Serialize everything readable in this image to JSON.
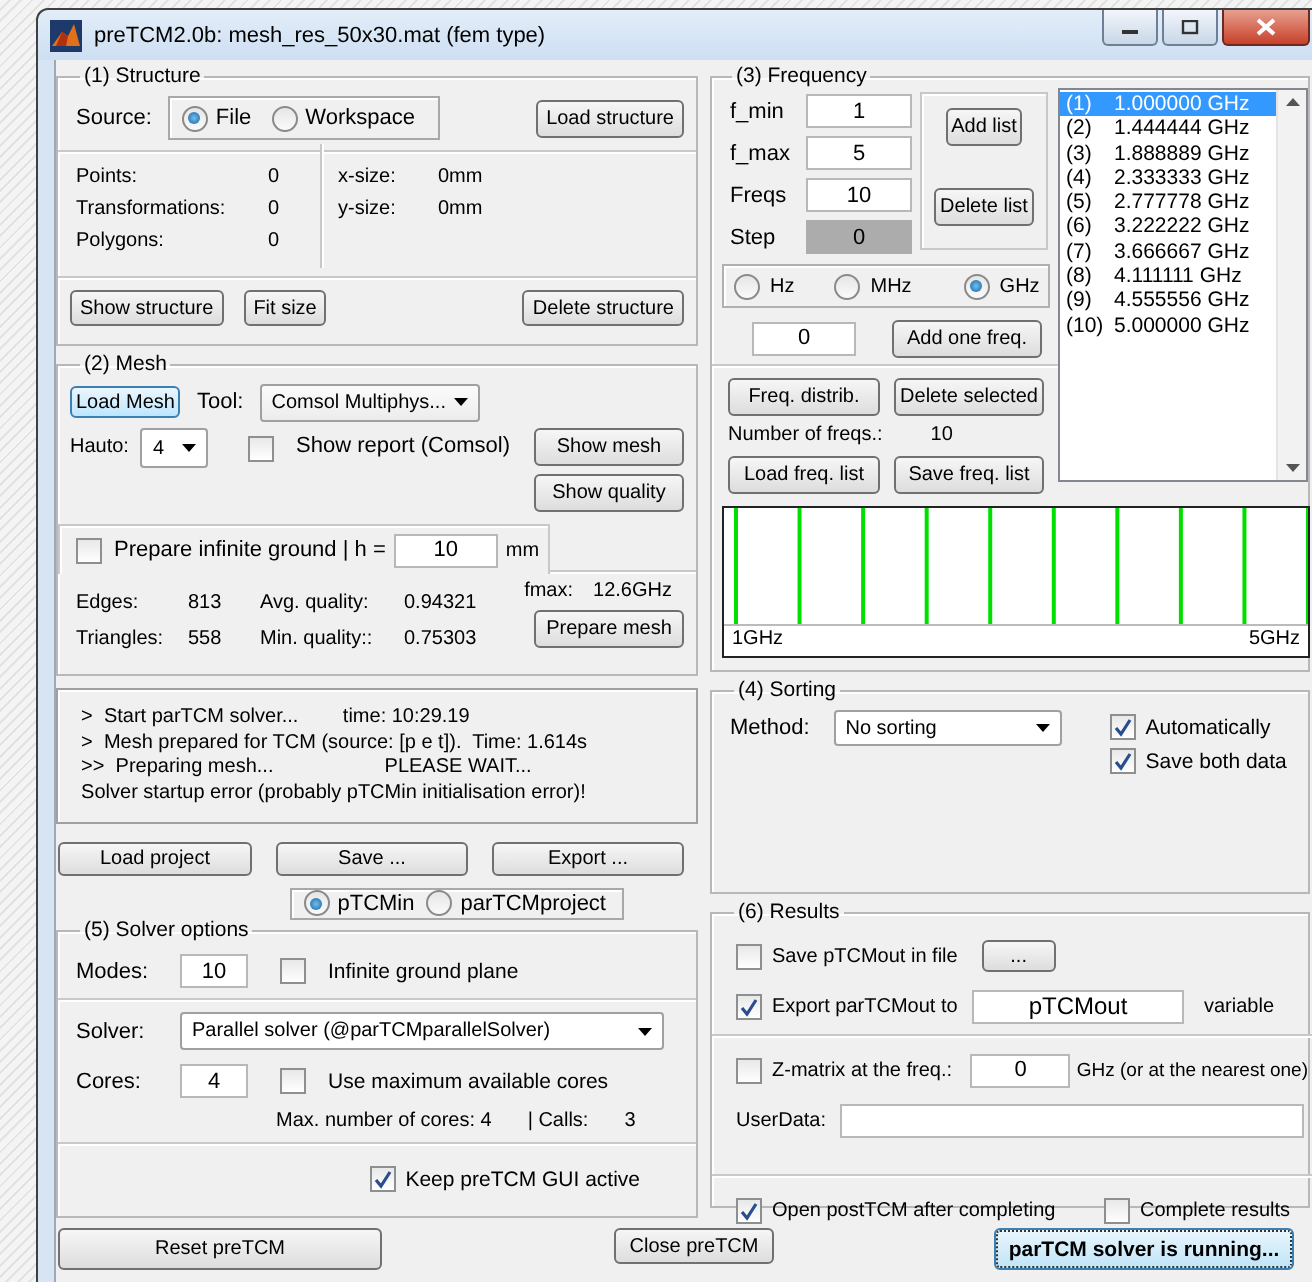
{
  "window": {
    "title": "preTCM2.0b:  mesh_res_50x30.mat (fem type)"
  },
  "structure": {
    "title": "(1) Structure",
    "source_label": "Source:",
    "sources": [
      {
        "label": "File",
        "selected": true
      },
      {
        "label": "Workspace",
        "selected": false
      }
    ],
    "load_button": "Load structure",
    "stats": [
      {
        "label": "Points:",
        "value": "0"
      },
      {
        "label": "Transformations:",
        "value": "0"
      },
      {
        "label": "Polygons:",
        "value": "0"
      }
    ],
    "sizes": [
      {
        "label": "x-size:",
        "value": "0mm"
      },
      {
        "label": "y-size:",
        "value": "0mm"
      }
    ],
    "buttons": [
      "Show structure",
      "Fit size",
      "Delete structure"
    ]
  },
  "mesh": {
    "title": "(2) Mesh",
    "load_button": "Load Mesh",
    "tool_label": "Tool:",
    "tool": "Comsol Multiphys...",
    "hauto_label": "Hauto:",
    "hauto": "4",
    "show_report": {
      "label": "Show report (Comsol)",
      "checked": false
    },
    "show_mesh": "Show mesh",
    "show_quality": "Show quality",
    "infinite_ground": {
      "label": "Prepare infinite ground  | h =",
      "checked": false
    },
    "h_value": "10",
    "h_unit": "mm",
    "fmax_label": "fmax:",
    "fmax": "12.6GHz",
    "stats": [
      {
        "label": "Edges:",
        "value": "813",
        "q_label": "Avg. quality:",
        "q_value": "0.94321"
      },
      {
        "label": "Triangles:",
        "value": "558",
        "q_label": "Min. quality::",
        "q_value": "0.75303"
      }
    ],
    "prepare_button": "Prepare mesh"
  },
  "log": [
    "  >  Start parTCM solver...        time: 10:29.19",
    "  >  Mesh prepared for TCM (source: [p e t]).  Time: 1.614s",
    "  >>  Preparing mesh...                    PLEASE WAIT...",
    "  Solver startup error (probably pTCMin initialisation error)!"
  ],
  "project_buttons": [
    "Load project",
    "Save ...",
    "Export ..."
  ],
  "project_source": [
    {
      "label": "pTCMin",
      "selected": true
    },
    {
      "label": "parTCMproject",
      "selected": false
    }
  ],
  "solver": {
    "title": "(5) Solver options",
    "modes_label": "Modes:",
    "modes": "10",
    "infinite_plane": {
      "label": "Infinite ground plane",
      "checked": false
    },
    "solver_label": "Solver:",
    "solver": "Parallel solver         (@parTCMparallelSolver)",
    "cores_label": "Cores:",
    "cores": "4",
    "use_max": {
      "label": "Use maximum available cores",
      "checked": false
    },
    "max_cores": "Max. number of cores: 4",
    "calls_label": "| Calls:",
    "calls": "3",
    "keep_active": {
      "label": "Keep preTCM GUI active",
      "checked": true
    }
  },
  "frequency": {
    "title": "(3) Frequency",
    "fields": [
      {
        "label": "f_min",
        "value": "1",
        "disabled": false
      },
      {
        "label": "f_max",
        "value": "5",
        "disabled": false
      },
      {
        "label": "Freqs",
        "value": "10",
        "disabled": false
      },
      {
        "label": "Step",
        "value": "0",
        "disabled": true
      }
    ],
    "add_list": "Add list",
    "delete_list": "Delete list",
    "units": [
      {
        "label": "Hz",
        "selected": false
      },
      {
        "label": "MHz",
        "selected": false
      },
      {
        "label": "GHz",
        "selected": true
      }
    ],
    "one_freq": "0",
    "add_one": "Add one freq.",
    "distrib": "Freq. distrib.",
    "delete_selected": "Delete selected",
    "count_label": "Number of freqs.:",
    "count": "10",
    "load_list": "Load freq. list",
    "save_list": "Save freq. list",
    "list": [
      {
        "index": "(1)",
        "value": "1.000000 GHz",
        "selected": true
      },
      {
        "index": "(2)",
        "value": "1.444444 GHz",
        "selected": false
      },
      {
        "index": "(3)",
        "value": "1.888889 GHz",
        "selected": false
      },
      {
        "index": "(4)",
        "value": "2.333333 GHz",
        "selected": false
      },
      {
        "index": "(5)",
        "value": "2.777778 GHz",
        "selected": false
      },
      {
        "index": "(6)",
        "value": "3.222222 GHz",
        "selected": false
      },
      {
        "index": "(7)",
        "value": "3.666667 GHz",
        "selected": false
      },
      {
        "index": "(8)",
        "value": "4.111111 GHz",
        "selected": false
      },
      {
        "index": "(9)",
        "value": "4.555556 GHz",
        "selected": false
      },
      {
        "index": "(10)",
        "value": "5.000000 GHz",
        "selected": false
      }
    ],
    "plot": {
      "min_label": "1GHz",
      "max_label": "5GHz"
    }
  },
  "sorting": {
    "title": "(4) Sorting",
    "method_label": "Method:",
    "method": "No sorting",
    "options": [
      {
        "label": "Automatically",
        "checked": true
      },
      {
        "label": "Save both data",
        "checked": true
      }
    ]
  },
  "results": {
    "title": "(6) Results",
    "save_file": {
      "label": "Save pTCMout in file",
      "checked": false
    },
    "browse": "...",
    "export": {
      "label": "Export parTCMout to",
      "checked": true
    },
    "variable": "pTCMout",
    "variable_suffix": "variable",
    "zmatrix": {
      "label": "Z-matrix at the freq.:",
      "checked": false
    },
    "zfreq": "0",
    "zunit": "GHz (or at the nearest one)",
    "userdata_label": "UserData:",
    "open_post": {
      "label": "Open postTCM after completing",
      "checked": true
    },
    "complete": {
      "label": "Complete results",
      "checked": false
    }
  },
  "reset_button": "Reset preTCM",
  "close_button": "Close preTCM",
  "status_button": "parTCM solver is running..."
}
